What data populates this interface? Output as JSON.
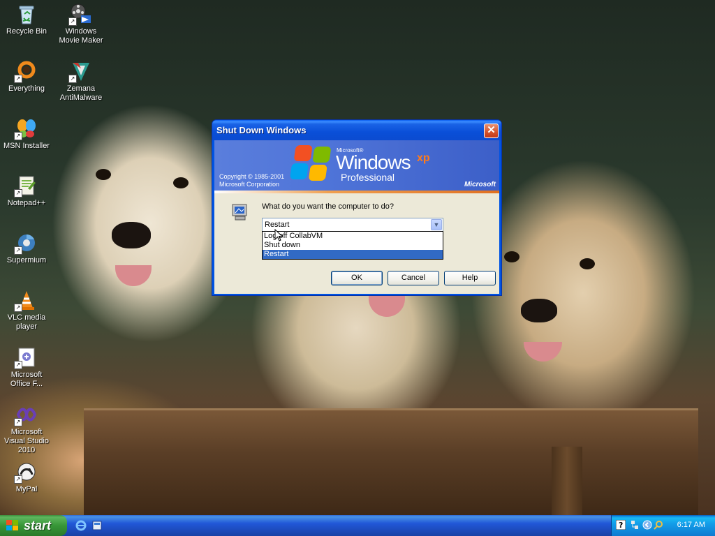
{
  "desktop": {
    "icons": [
      {
        "label": "Recycle Bin",
        "icon": "recycle-bin-icon"
      },
      {
        "label": "Windows Movie Maker",
        "icon": "movie-maker-icon"
      },
      {
        "label": "Everything",
        "icon": "everything-search-icon"
      },
      {
        "label": "Zemana AntiMalware",
        "icon": "zemana-icon"
      },
      {
        "label": "MSN Installer",
        "icon": "msn-butterfly-icon"
      },
      {
        "label": "Notepad++",
        "icon": "notepad-plus-plus-icon"
      },
      {
        "label": "Supermium",
        "icon": "supermium-browser-icon"
      },
      {
        "label": "VLC media player",
        "icon": "vlc-cone-icon"
      },
      {
        "label": "Microsoft Office F...",
        "icon": "office-file-icon"
      },
      {
        "label": "Microsoft Visual Studio 2010",
        "icon": "visual-studio-icon"
      },
      {
        "label": "MyPal",
        "icon": "mypal-browser-icon"
      }
    ]
  },
  "dialog": {
    "title": "Shut Down Windows",
    "close_label": "✕",
    "banner": {
      "copyright_line1": "Copyright © 1985-2001",
      "copyright_line2": "Microsoft Corporation",
      "ms_small": "Microsoft®",
      "windows": "Windows",
      "xp": "xp",
      "edition": "Professional",
      "brand": "Microsoft"
    },
    "question": "What do you want the computer to do?",
    "selected_value": "Restart",
    "options": [
      "Log off CollabVM",
      "Shut down",
      "Restart"
    ],
    "buttons": {
      "ok": "OK",
      "cancel": "Cancel",
      "help": "Help"
    }
  },
  "taskbar": {
    "start_label": "start",
    "quick_launch": [
      "internet-explorer-icon",
      "show-desktop-icon"
    ],
    "tray_icons": [
      "help-icon",
      "network-icon",
      "expand-tray-icon",
      "search-icon"
    ],
    "clock": "6:17 AM"
  },
  "colors": {
    "title_blue": "#0054e3",
    "dialog_face": "#ece9d8",
    "selection": "#316ac5",
    "start_green": "#379637",
    "tray_blue": "#139ee9"
  }
}
